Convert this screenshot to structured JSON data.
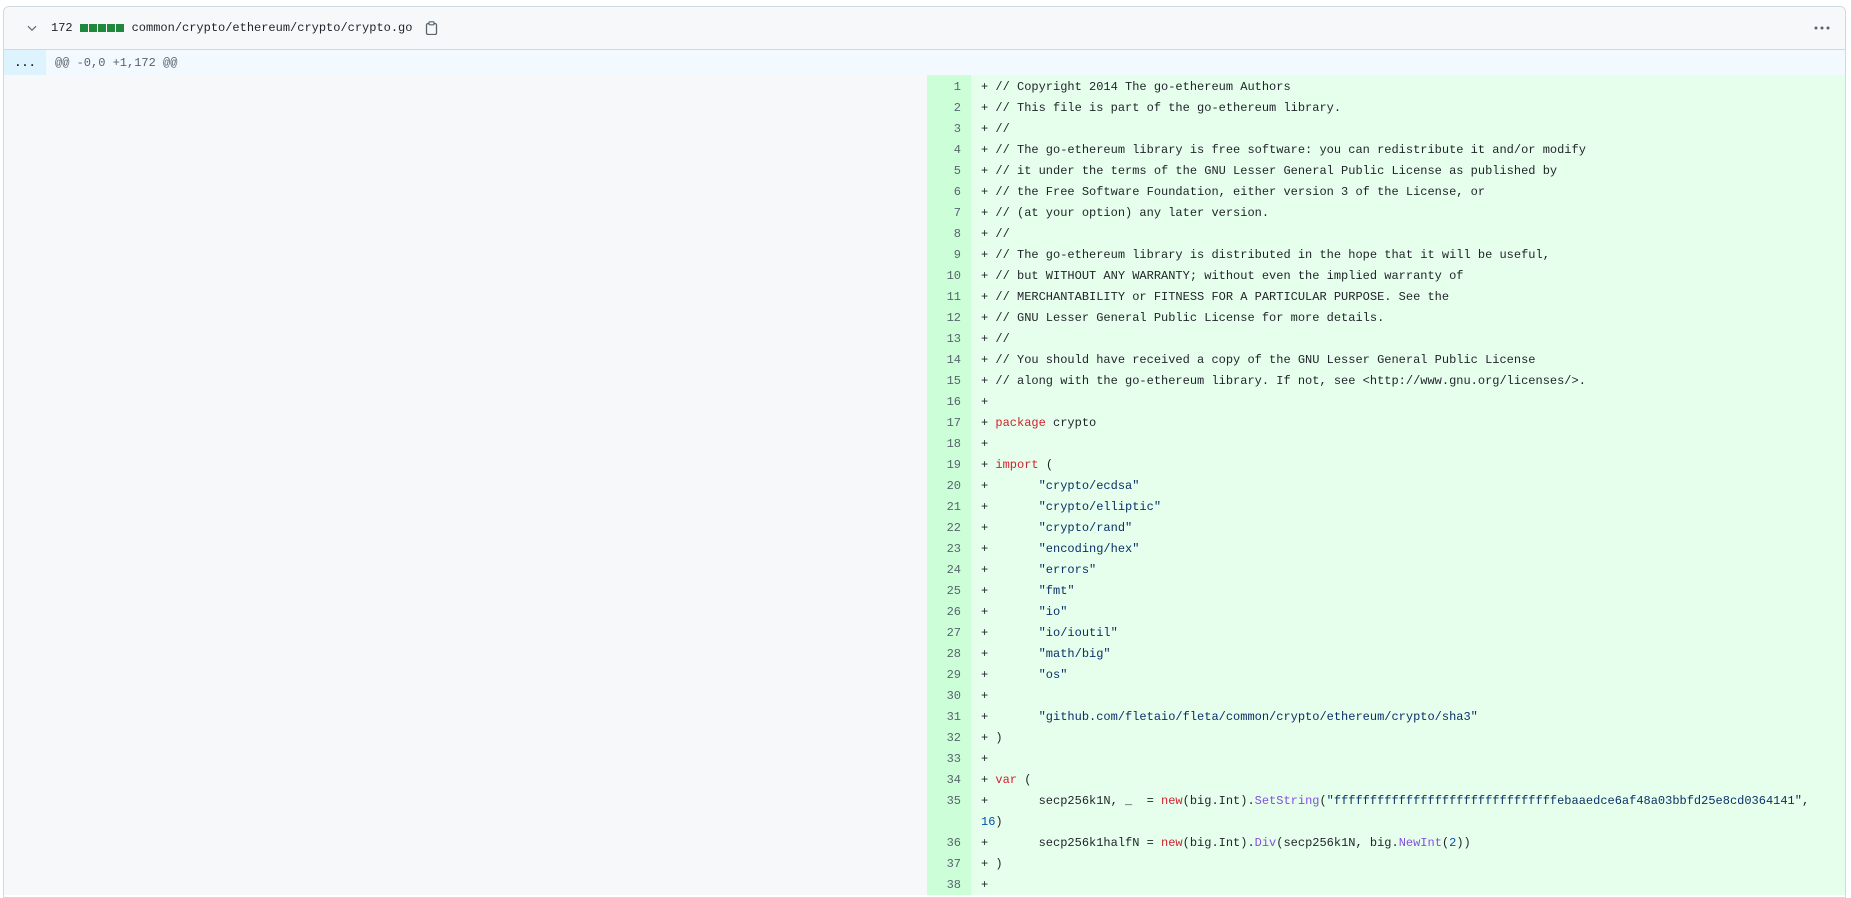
{
  "header": {
    "count": "172",
    "path": "common/crypto/ethereum/crypto/crypto.go",
    "diffstat_blocks": 5
  },
  "hunk": {
    "expand_label": "...",
    "text": "@@ -0,0 +1,172 @@"
  },
  "colors": {
    "addition_bg": "#e6ffec",
    "addition_gutter": "#ccffd8",
    "diffstat_green": "#1f883d",
    "hunk_bg": "#ddf4ff",
    "keyword": "#cf222e",
    "string": "#0a3069",
    "function": "#8250df",
    "number": "#0550ae"
  },
  "lines": [
    {
      "n": "1",
      "t": [
        [
          "+ // Copyright 2014 The go-ethereum Authors",
          ""
        ]
      ]
    },
    {
      "n": "2",
      "t": [
        [
          "+ // This file is part of the go-ethereum library.",
          ""
        ]
      ]
    },
    {
      "n": "3",
      "t": [
        [
          "+ //",
          ""
        ]
      ]
    },
    {
      "n": "4",
      "t": [
        [
          "+ // The go-ethereum library is free software: you can redistribute it and/or modify",
          ""
        ]
      ]
    },
    {
      "n": "5",
      "t": [
        [
          "+ // it under the terms of the GNU Lesser General Public License as published by",
          ""
        ]
      ]
    },
    {
      "n": "6",
      "t": [
        [
          "+ // the Free Software Foundation, either version 3 of the License, or",
          ""
        ]
      ]
    },
    {
      "n": "7",
      "t": [
        [
          "+ // (at your option) any later version.",
          ""
        ]
      ]
    },
    {
      "n": "8",
      "t": [
        [
          "+ //",
          ""
        ]
      ]
    },
    {
      "n": "9",
      "t": [
        [
          "+ // The go-ethereum library is distributed in the hope that it will be useful,",
          ""
        ]
      ]
    },
    {
      "n": "10",
      "t": [
        [
          "+ // but WITHOUT ANY WARRANTY; without even the implied warranty of",
          ""
        ]
      ]
    },
    {
      "n": "11",
      "t": [
        [
          "+ // MERCHANTABILITY or FITNESS FOR A PARTICULAR PURPOSE. See the",
          ""
        ]
      ]
    },
    {
      "n": "12",
      "t": [
        [
          "+ // GNU Lesser General Public License for more details.",
          ""
        ]
      ]
    },
    {
      "n": "13",
      "t": [
        [
          "+ //",
          ""
        ]
      ]
    },
    {
      "n": "14",
      "t": [
        [
          "+ // You should have received a copy of the GNU Lesser General Public License",
          ""
        ]
      ]
    },
    {
      "n": "15",
      "t": [
        [
          "+ // along with the go-ethereum library. If not, see <http://www.gnu.org/licenses/>.",
          ""
        ]
      ]
    },
    {
      "n": "16",
      "t": [
        [
          "+",
          ""
        ]
      ]
    },
    {
      "n": "17",
      "t": [
        [
          "+ ",
          ""
        ],
        [
          "package",
          "kw"
        ],
        [
          " crypto",
          ""
        ]
      ]
    },
    {
      "n": "18",
      "t": [
        [
          "+",
          ""
        ]
      ]
    },
    {
      "n": "19",
      "t": [
        [
          "+ ",
          ""
        ],
        [
          "import",
          "kw"
        ],
        [
          " (",
          ""
        ]
      ]
    },
    {
      "n": "20",
      "t": [
        [
          "+       ",
          ""
        ],
        [
          "\"crypto/ecdsa\"",
          "st"
        ]
      ]
    },
    {
      "n": "21",
      "t": [
        [
          "+       ",
          ""
        ],
        [
          "\"crypto/elliptic\"",
          "st"
        ]
      ]
    },
    {
      "n": "22",
      "t": [
        [
          "+       ",
          ""
        ],
        [
          "\"crypto/rand\"",
          "st"
        ]
      ]
    },
    {
      "n": "23",
      "t": [
        [
          "+       ",
          ""
        ],
        [
          "\"encoding/hex\"",
          "st"
        ]
      ]
    },
    {
      "n": "24",
      "t": [
        [
          "+       ",
          ""
        ],
        [
          "\"errors\"",
          "st"
        ]
      ]
    },
    {
      "n": "25",
      "t": [
        [
          "+       ",
          ""
        ],
        [
          "\"fmt\"",
          "st"
        ]
      ]
    },
    {
      "n": "26",
      "t": [
        [
          "+       ",
          ""
        ],
        [
          "\"io\"",
          "st"
        ]
      ]
    },
    {
      "n": "27",
      "t": [
        [
          "+       ",
          ""
        ],
        [
          "\"io/ioutil\"",
          "st"
        ]
      ]
    },
    {
      "n": "28",
      "t": [
        [
          "+       ",
          ""
        ],
        [
          "\"math/big\"",
          "st"
        ]
      ]
    },
    {
      "n": "29",
      "t": [
        [
          "+       ",
          ""
        ],
        [
          "\"os\"",
          "st"
        ]
      ]
    },
    {
      "n": "30",
      "t": [
        [
          "+",
          ""
        ]
      ]
    },
    {
      "n": "31",
      "t": [
        [
          "+       ",
          ""
        ],
        [
          "\"github.com/fletaio/fleta/common/crypto/ethereum/crypto/sha3\"",
          "st"
        ]
      ]
    },
    {
      "n": "32",
      "t": [
        [
          "+ )",
          ""
        ]
      ]
    },
    {
      "n": "33",
      "t": [
        [
          "+",
          ""
        ]
      ]
    },
    {
      "n": "34",
      "t": [
        [
          "+ ",
          ""
        ],
        [
          "var",
          "kw"
        ],
        [
          " (",
          ""
        ]
      ]
    },
    {
      "n": "35",
      "t": [
        [
          "+       secp256k1N, _  = ",
          ""
        ],
        [
          "new",
          "kw"
        ],
        [
          "(big.Int).",
          ""
        ],
        [
          "SetString",
          "fn"
        ],
        [
          "(",
          ""
        ],
        [
          "\"fffffffffffffffffffffffffffffffebaaedce6af48a03bbfd25e8cd0364141\"",
          "st"
        ],
        [
          ", ",
          ""
        ],
        [
          "16",
          "nu"
        ],
        [
          ")",
          ""
        ]
      ]
    },
    {
      "n": "36",
      "t": [
        [
          "+       secp256k1halfN = ",
          ""
        ],
        [
          "new",
          "kw"
        ],
        [
          "(big.Int).",
          ""
        ],
        [
          "Div",
          "fn"
        ],
        [
          "(secp256k1N, big.",
          ""
        ],
        [
          "NewInt",
          "fn"
        ],
        [
          "(",
          ""
        ],
        [
          "2",
          "nu"
        ],
        [
          "))",
          ""
        ]
      ]
    },
    {
      "n": "37",
      "t": [
        [
          "+ )",
          ""
        ]
      ]
    },
    {
      "n": "38",
      "t": [
        [
          "+",
          ""
        ]
      ]
    }
  ]
}
